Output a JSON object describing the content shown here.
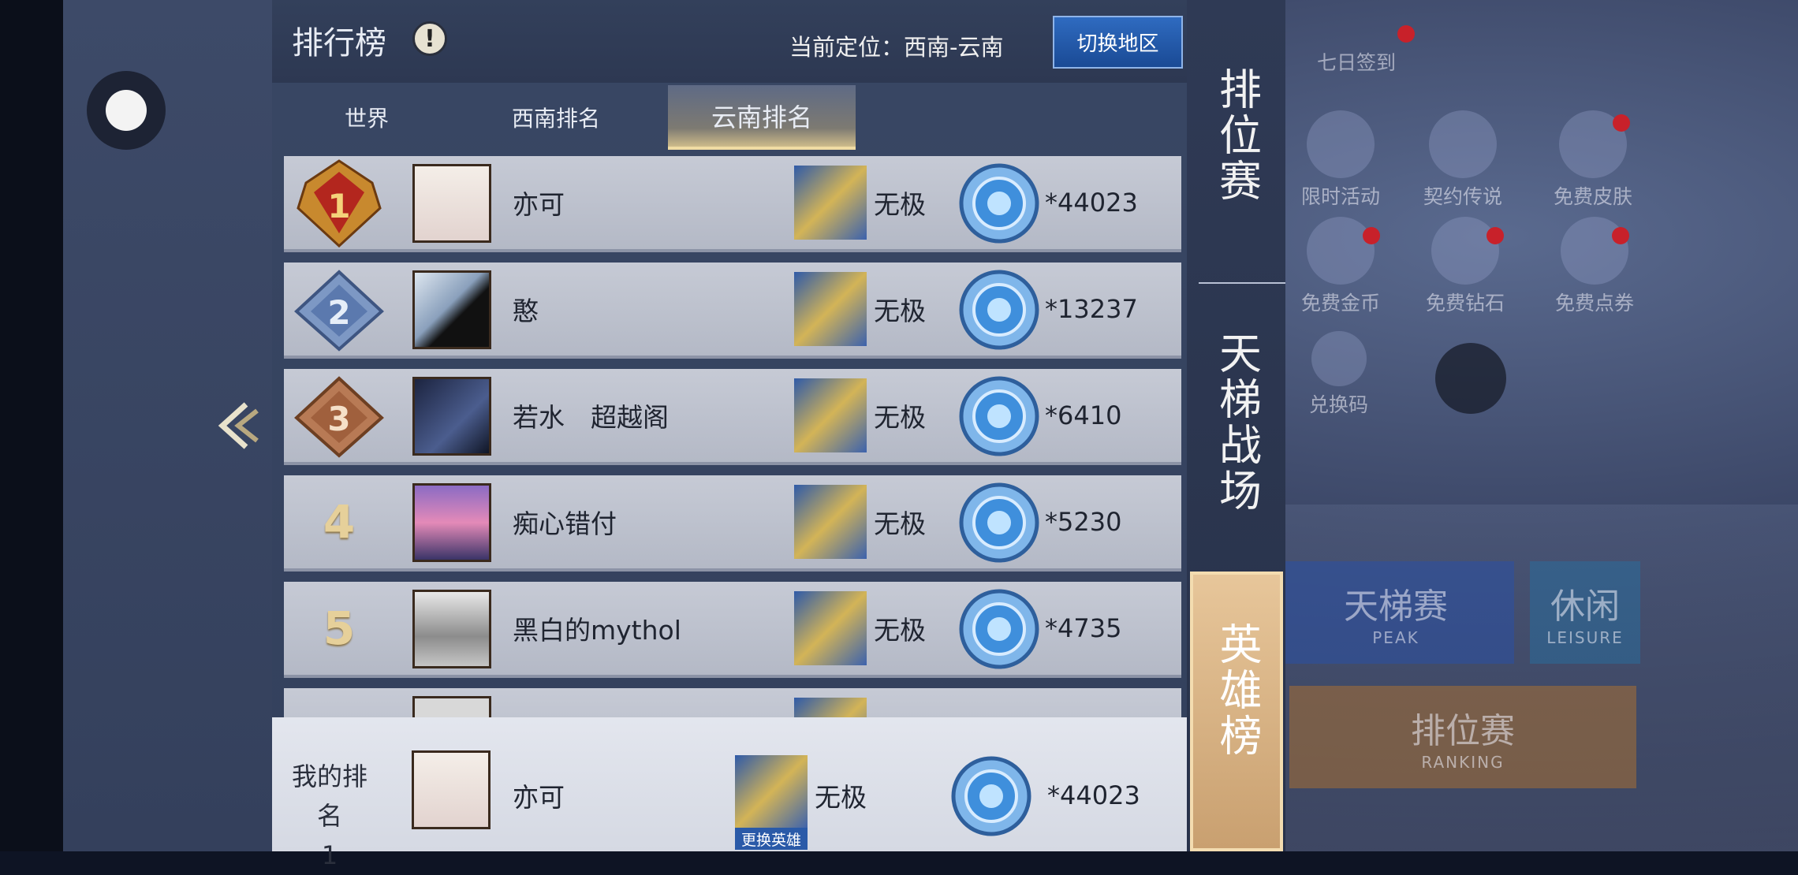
{
  "header": {
    "title": "排行榜",
    "info_symbol": "!",
    "location": "当前定位：西南-云南",
    "switch_button": "切换地区"
  },
  "tabs": [
    {
      "label": "世界",
      "active": false
    },
    {
      "label": "西南排名",
      "active": false
    },
    {
      "label": "云南排名",
      "active": true
    }
  ],
  "rows": [
    {
      "rank": "1",
      "name": "亦可",
      "hero": "无极",
      "score": "*44023"
    },
    {
      "rank": "2",
      "name": "憨",
      "hero": "无极",
      "score": "*13237"
    },
    {
      "rank": "3",
      "name": "若水　超越阁",
      "hero": "无极",
      "score": "*6410"
    },
    {
      "rank": "4",
      "name": "痴心错付",
      "hero": "无极",
      "score": "*5230"
    },
    {
      "rank": "5",
      "name": "黑白的mythol",
      "hero": "无极",
      "score": "*4735"
    }
  ],
  "my_rank": {
    "label": "我的排名",
    "rank": "1",
    "name": "亦可",
    "hero": "无极",
    "change_hero": "更换英雄",
    "score": "*44023"
  },
  "categories": [
    {
      "label": "排位赛",
      "active": false
    },
    {
      "label": "天梯战场",
      "active": false
    },
    {
      "label": "英雄榜",
      "active": true
    }
  ],
  "background": {
    "daily_signin": "七日签到",
    "limited_event": "限时活动",
    "contract_legend": "契约传说",
    "free_skin": "免费皮肤",
    "free_gold": "免费金币",
    "free_diamond": "免费钻石",
    "free_voucher": "免费点券",
    "redeem_code": "兑换码",
    "ladder": "天梯赛",
    "ladder_en": "PEAK",
    "leisure": "休闲",
    "leisure_en": "LEISURE",
    "ranked": "排位赛",
    "ranked_en": "RANKING"
  },
  "colors": {
    "accent_gold": "#f0dca4",
    "switch_blue": "#2f6bc0",
    "row_bg": "#c6cad5"
  }
}
